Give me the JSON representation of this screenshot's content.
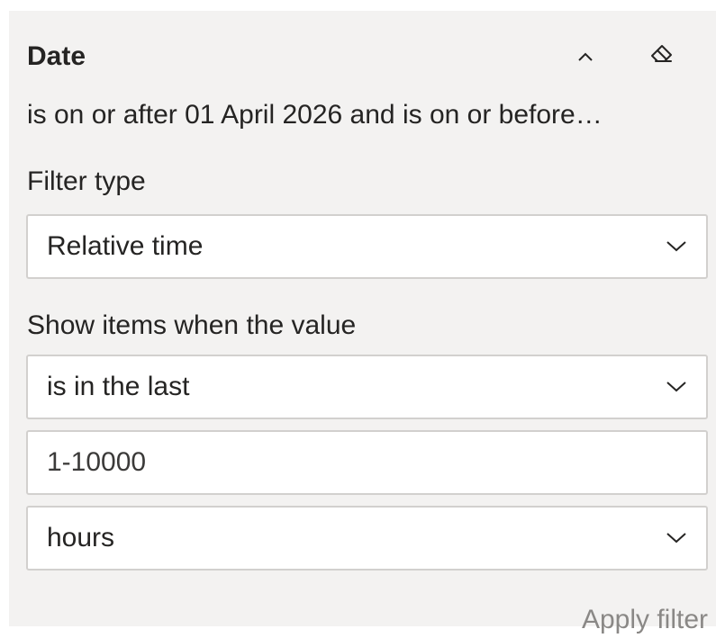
{
  "filter_card": {
    "title": "Date",
    "summary": "is on or after 01 April 2026 and is on or before…",
    "icons": {
      "collapse": "chevron-up-icon",
      "clear": "eraser-icon"
    },
    "filter_type": {
      "label": "Filter type",
      "selected": "Relative time"
    },
    "condition": {
      "label": "Show items when the value",
      "operator": "is in the last",
      "number_placeholder": "1-10000",
      "unit": "hours"
    },
    "apply_label": "Apply filter"
  },
  "colors": {
    "card_background": "#f3f2f1",
    "field_border": "#d2d0ce",
    "text": "#252423",
    "disabled_text": "#8a8886"
  }
}
